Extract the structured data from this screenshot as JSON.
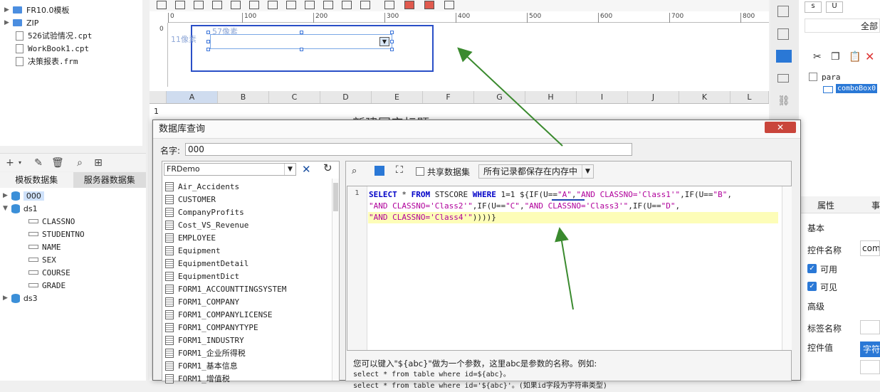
{
  "file_tree": [
    {
      "label": "FR10.0模板",
      "type": "folder"
    },
    {
      "label": "ZIP",
      "type": "folder"
    },
    {
      "label": "526试验情况.cpt",
      "type": "file"
    },
    {
      "label": "WorkBook1.cpt",
      "type": "file"
    },
    {
      "label": "决策报表.frm",
      "type": "file"
    }
  ],
  "dataset_tabs": [
    "模板数据集",
    "服务器数据集"
  ],
  "datasets": {
    "ds0": "000",
    "ds1": "ds1",
    "ds1_fields": [
      "CLASSNO",
      "STUDENTNO",
      "NAME",
      "SEX",
      "COURSE",
      "GRADE"
    ],
    "ds3": "ds3"
  },
  "designer": {
    "ruler_ticks": [
      "0",
      "100",
      "200",
      "300",
      "400",
      "500",
      "600",
      "700",
      "800"
    ],
    "vruler_tick": "0",
    "label_height": "11像素",
    "label_width": "57像素"
  },
  "sheet": {
    "columns": [
      "A",
      "B",
      "C",
      "D",
      "E",
      "F",
      "G",
      "H",
      "I",
      "J",
      "K",
      "L"
    ],
    "row1": "1",
    "title_text": "新建国产标题"
  },
  "right_panel": {
    "btn_s": "s",
    "btn_u": "U",
    "all_label": "全部",
    "tree_root": "para",
    "tree_child": "comboBox0",
    "props_tab": "属性",
    "props_tab2": "事",
    "section_basic": "基本",
    "widget_name_label": "控件名称",
    "widget_name_value": "com",
    "enabled_label": "可用",
    "visible_label": "可见",
    "section_advanced": "高级",
    "tag_name_label": "标签名称",
    "widget_value_label": "控件值",
    "widget_value_value": "字符"
  },
  "dialog": {
    "title": "数据库查询",
    "close": "✕",
    "name_label": "名字:",
    "name_value": "000",
    "db_connection": "FRDemo",
    "tables": [
      "Air_Accidents",
      "CUSTOMER",
      "CompanyProfits",
      "Cost_VS_Revenue",
      "EMPLOYEE",
      "Equipment",
      "EquipmentDetail",
      "EquipmentDict",
      "FORM1_ACCOUNTTINGSYSTEM",
      "FORM1_COMPANY",
      "FORM1_COMPANYLICENSE",
      "FORM1_COMPANYTYPE",
      "FORM1_INDUSTRY",
      "FORM1_企业所得税",
      "FORM1_基本信息",
      "FORM1_增值税"
    ],
    "shared_dataset_label": "共享数据集",
    "cache_option": "所有记录都保存在内存中",
    "line_number": "1",
    "sql_line1_a": "SELECT",
    "sql_line1_b": " * ",
    "sql_line1_c": "FROM",
    "sql_line1_d": " STSCORE ",
    "sql_line1_e": "WHERE",
    "sql_line1_f": " 1=1 ${IF(U==",
    "sql_line1_g": "\"A\"",
    "sql_line1_h": ",",
    "sql_line1_i": "\"AND CLASSNO='Class1'\"",
    "sql_line1_j": ",IF(U==",
    "sql_line1_k": "\"B\"",
    "sql_line1_l": ",",
    "sql_line2_a": "\"AND CLASSNO='Class2'\"",
    "sql_line2_b": ",IF(U==",
    "sql_line2_c": "\"C\"",
    "sql_line2_d": ",",
    "sql_line2_e": "\"AND CLASSNO='Class3'\"",
    "sql_line2_f": ",IF(U==",
    "sql_line2_g": "\"D\"",
    "sql_line2_h": ",",
    "sql_line3_a": "\"AND CLASSNO='Class4'\"",
    "sql_line3_b": "))))}",
    "hint_line1": "您可以键入\"${abc}\"做为一个参数，这里abc是参数的名称。例如:",
    "hint_line2": "select * from table where id=${abc}。",
    "hint_line3": "select * from table where id='${abc}'。(如果id字段为字符串类型)"
  },
  "colors": {
    "accent": "#2a78d6",
    "arrow": "#3a8a2e",
    "selection_border": "#2a4fc7",
    "close_red": "#c9453b"
  }
}
